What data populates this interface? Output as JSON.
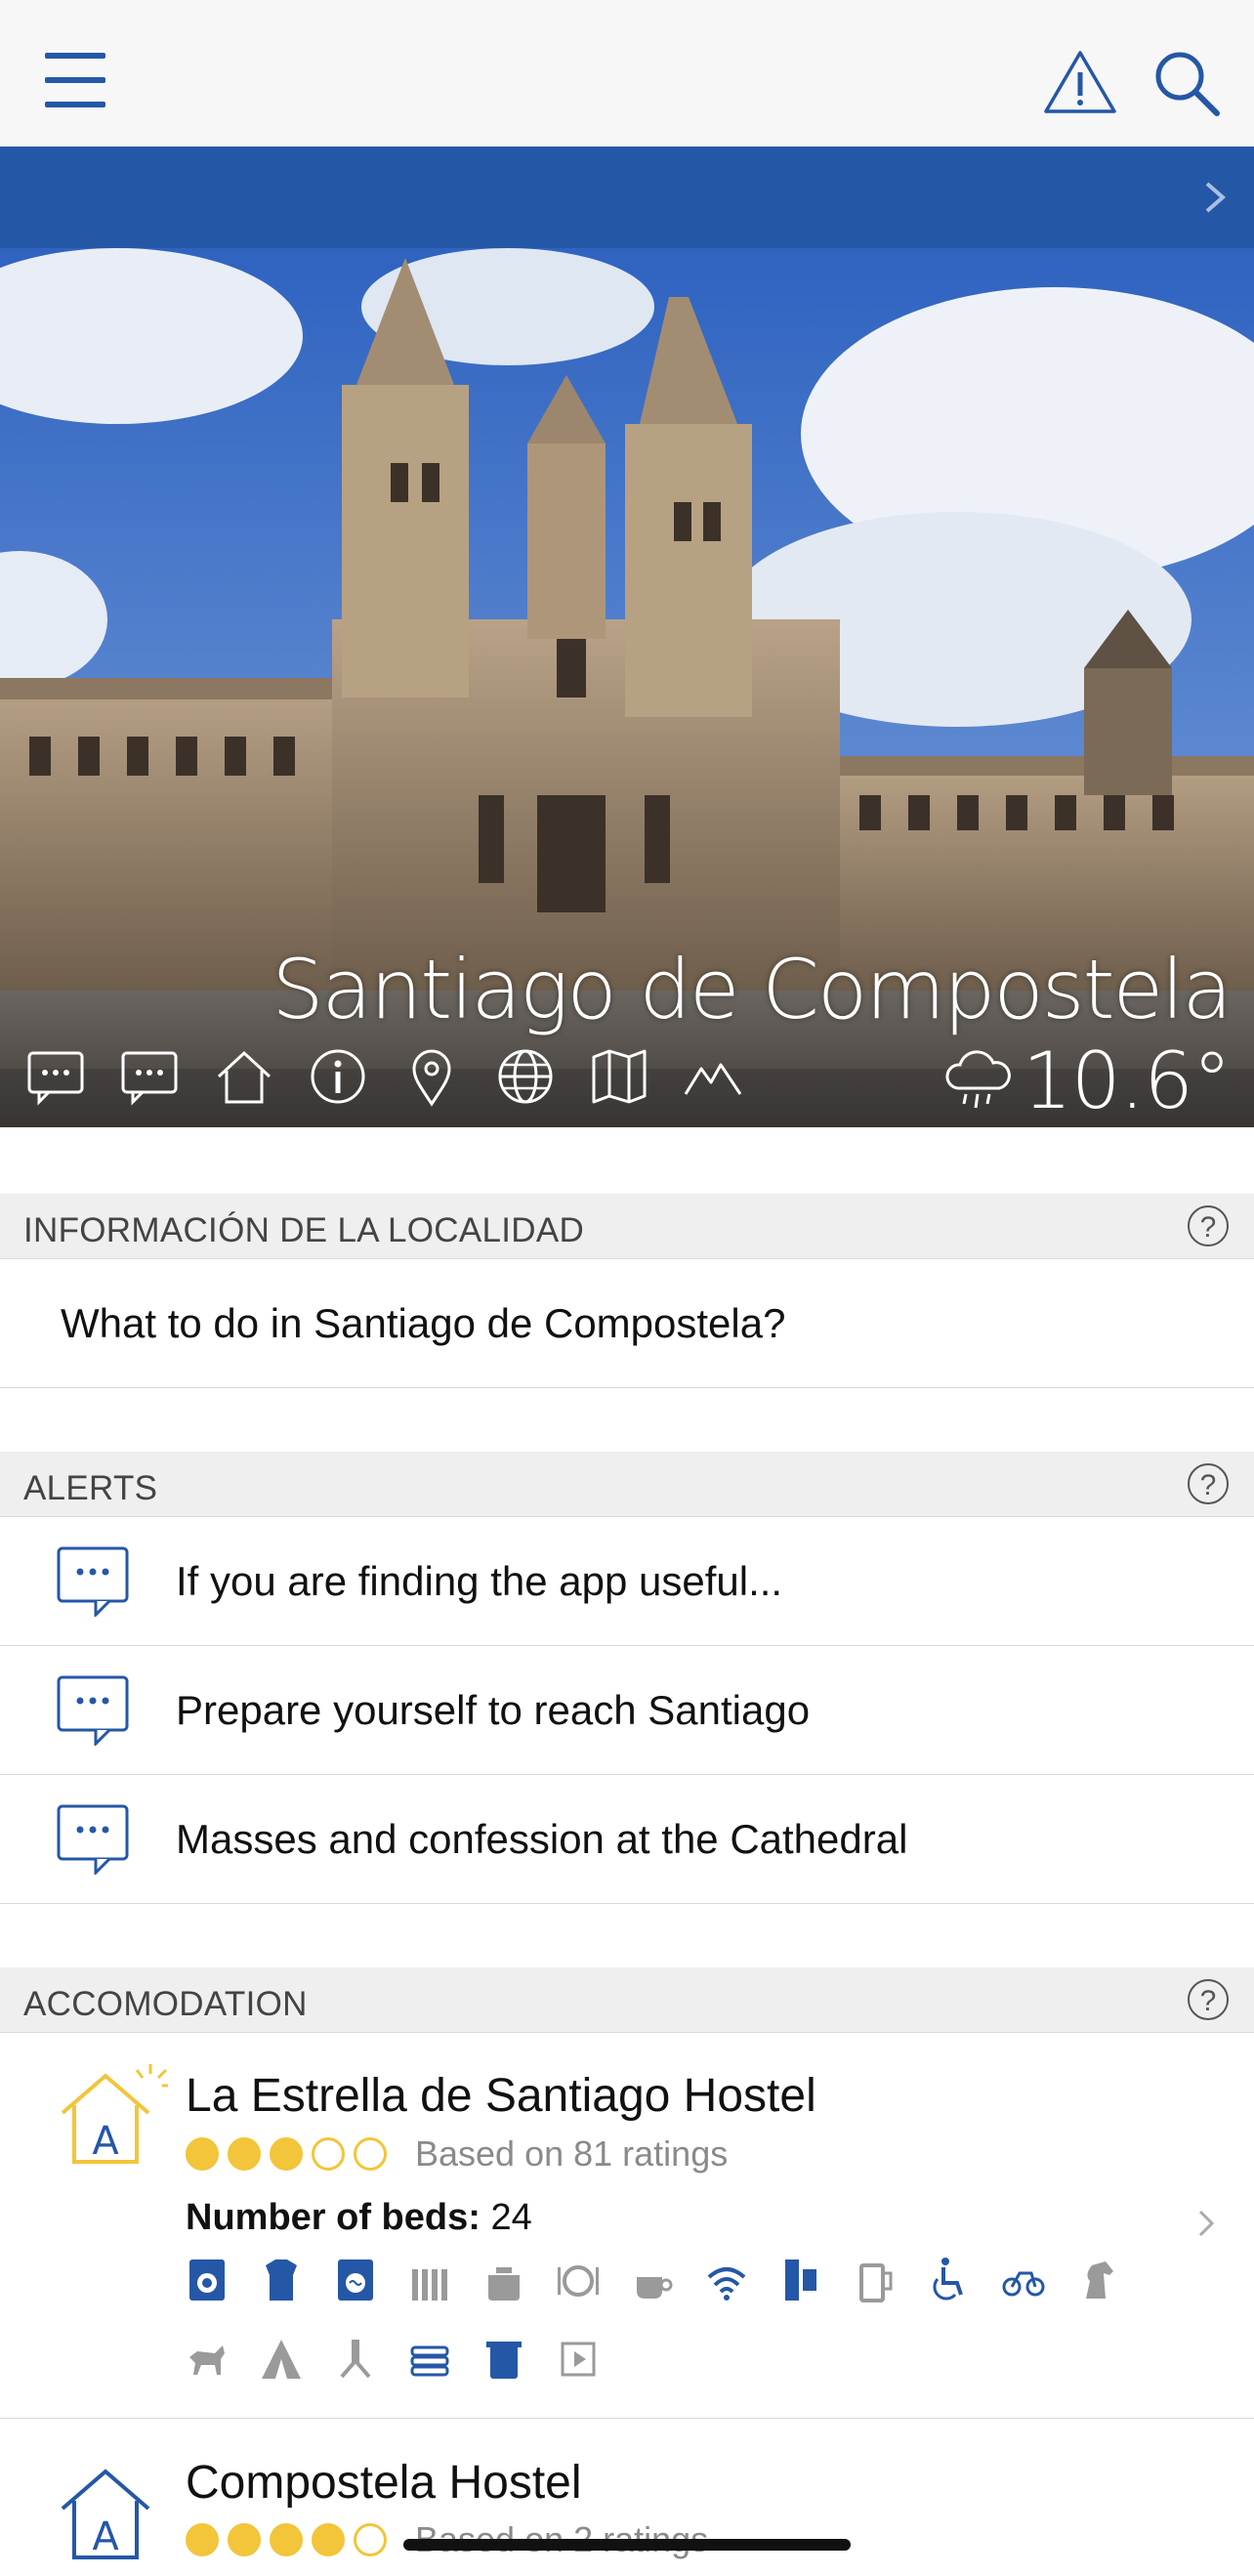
{
  "city": {
    "name": "Santiago de Compostela",
    "temperature": "10.6°",
    "weather_icon": "rain-cloud-icon"
  },
  "hero_icons": [
    "alerts-icon",
    "comments-icon",
    "home-icon",
    "info-icon",
    "location-pin-icon",
    "globe-icon",
    "map-icon",
    "elevation-icon"
  ],
  "sections": {
    "info": {
      "title": "INFORMACIÓN DE LA LOCALIDAD",
      "help": "?",
      "items": [
        "What to do in Santiago de Compostela?"
      ]
    },
    "alerts": {
      "title": "ALERTS",
      "help": "?",
      "items": [
        "If you are finding the app useful...",
        "Prepare yourself to reach Santiago",
        "Masses and confession at the Cathedral"
      ]
    },
    "accommodation": {
      "title": "ACCOMODATION",
      "help": "?"
    }
  },
  "accommodations": [
    {
      "name": "La Estrella de Santiago Hostel",
      "rating_filled": 3,
      "rating_max": 5,
      "ratings_text": "Based on 81 ratings",
      "beds_label": "Number of beds:",
      "beds_value": "24",
      "amenities": [
        "washing-machine-icon",
        "laundry-icon",
        "dryer-icon",
        "heating-icon",
        "kitchen-icon",
        "restaurant-icon",
        "coffee-icon",
        "wifi-icon",
        "lockers-icon",
        "beer-icon",
        "wheelchair-icon",
        "bicycle-icon",
        "horse-icon",
        "pets-icon",
        "camping-icon",
        "prayer-icon",
        "bed-linen-icon",
        "towels-icon",
        "vending-icon"
      ],
      "colors": {
        "active": "#2557a7",
        "inactive": "#9a9a9a"
      }
    },
    {
      "name": "Compostela Hostel",
      "rating_filled": 4,
      "rating_max": 5,
      "ratings_text": "Based on 2 ratings"
    }
  ],
  "colors": {
    "brand_blue": "#2557a7",
    "star": "#f2c53a",
    "header_bg": "#efefef"
  }
}
